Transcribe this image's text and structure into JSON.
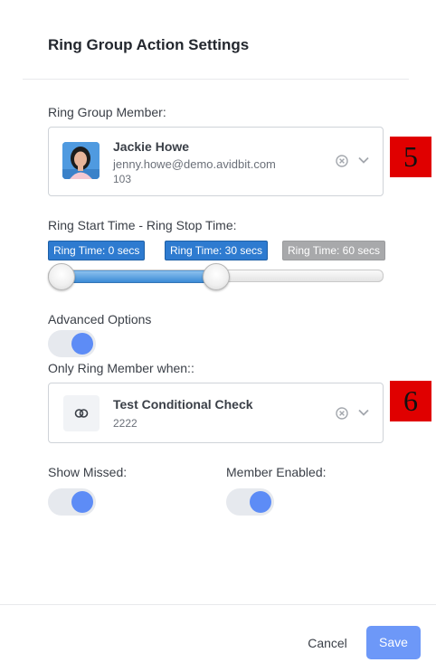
{
  "dialog": {
    "title": "Ring Group Action Settings"
  },
  "member": {
    "label": "Ring Group Member:",
    "name": "Jackie Howe",
    "email": "jenny.howe@demo.avidbit.com",
    "extension": "103"
  },
  "ring_time": {
    "label": "Ring Start Time - Ring Stop Time:",
    "start_label": "Ring Time: 0 secs",
    "stop_label": "Ring Time: 30 secs",
    "max_label": "Ring Time: 60 secs",
    "start_value_secs": 0,
    "stop_value_secs": 30,
    "max_value_secs": 60
  },
  "advanced": {
    "label": "Advanced Options",
    "enabled": true
  },
  "condition": {
    "label": "Only Ring Member when::",
    "name": "Test Conditional Check",
    "code": "2222"
  },
  "show_missed": {
    "label": "Show Missed:",
    "enabled": true
  },
  "member_enabled": {
    "label": "Member Enabled:",
    "enabled": true
  },
  "markers": {
    "member_marker": "5",
    "condition_marker": "6"
  },
  "footer": {
    "cancel_label": "Cancel",
    "save_label": "Save"
  },
  "colors": {
    "accent": "#6d98f8",
    "toggle_knob": "#5d8cf6",
    "pill_blue": "#2e7bd0",
    "pill_grey": "#a8a9ab",
    "marker_red": "#e00000"
  }
}
